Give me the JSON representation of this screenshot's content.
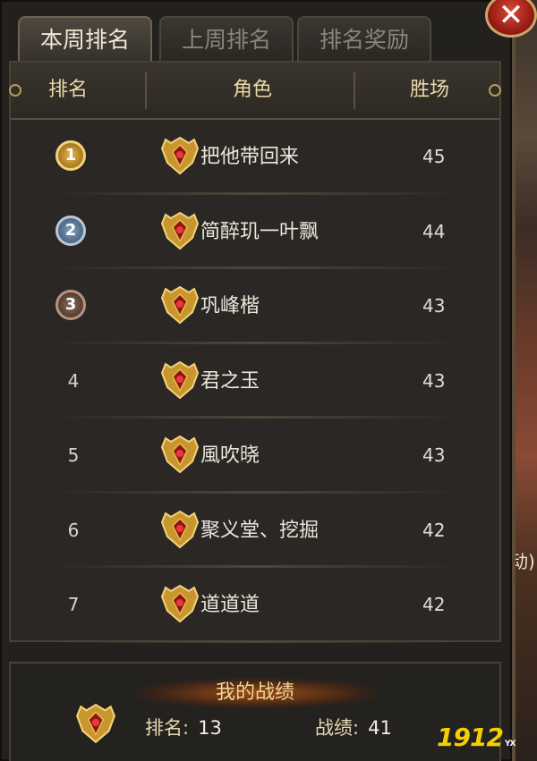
{
  "tabs": [
    {
      "label": "本周排名",
      "active": true
    },
    {
      "label": "上周排名",
      "active": false
    },
    {
      "label": "排名奖励",
      "active": false
    }
  ],
  "close_icon": "close-icon",
  "table": {
    "headers": {
      "rank": "排名",
      "role": "角色",
      "wins": "胜场"
    },
    "rows": [
      {
        "rank": "1",
        "medal": "gold",
        "name": "把他带回来",
        "wins": "45"
      },
      {
        "rank": "2",
        "medal": "silver",
        "name": "简醉玑一叶飘",
        "wins": "44"
      },
      {
        "rank": "3",
        "medal": "bronze",
        "name": "巩峰楷",
        "wins": "43"
      },
      {
        "rank": "4",
        "medal": "",
        "name": "君之玉",
        "wins": "43"
      },
      {
        "rank": "5",
        "medal": "",
        "name": "風吹晓",
        "wins": "43"
      },
      {
        "rank": "6",
        "medal": "",
        "name": "聚义堂、挖掘",
        "wins": "42"
      },
      {
        "rank": "7",
        "medal": "",
        "name": "道道道",
        "wins": "42"
      }
    ]
  },
  "my_record": {
    "title": "我的战绩",
    "rank_label": "排名:",
    "rank_value": "13",
    "score_label": "战绩:",
    "score_value": "41"
  },
  "background_fragment": "动)",
  "watermark": {
    "text": "1912",
    "sub": "YX"
  },
  "colors": {
    "accent": "#e9d8a8",
    "gold": "#e8b84a",
    "close": "#c0281c"
  }
}
